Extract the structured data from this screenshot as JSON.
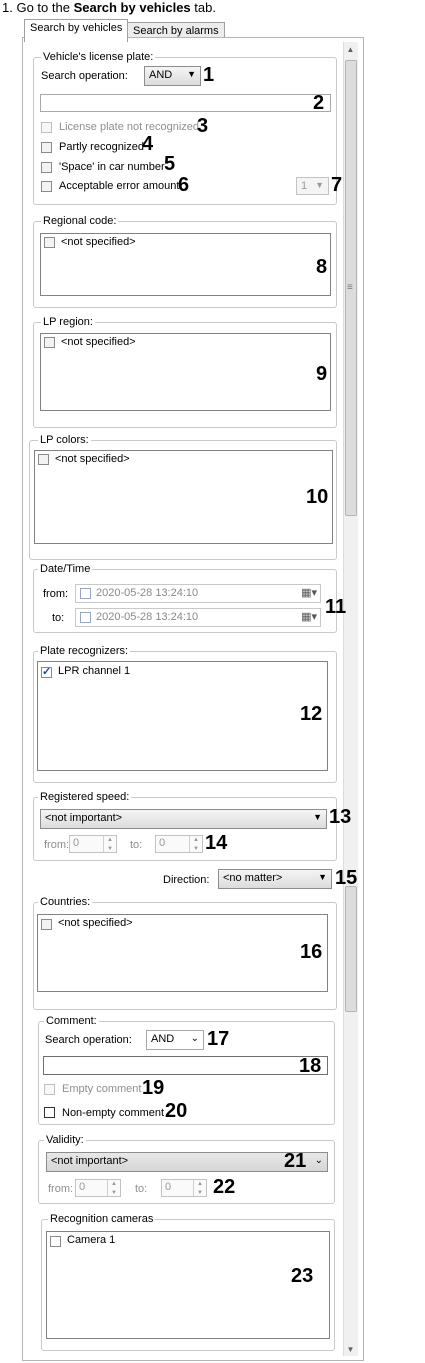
{
  "intro": {
    "number": "1.",
    "prefix": "Go to the",
    "tab_name": "Search by vehicles",
    "suffix": "tab."
  },
  "tabs": [
    "Search by vehicles",
    "Search by alarms"
  ],
  "plate": {
    "legend": "Vehicle's license plate:",
    "search_operation_label": "Search operation:",
    "search_operation_value": "AND",
    "plate_value": "",
    "not_recognized_label": "License plate not recognized",
    "partly_label": "Partly recognized",
    "space_label": "'Space' in car number",
    "error_label": "Acceptable error amount",
    "error_value": "1"
  },
  "regional": {
    "legend": "Regional code:",
    "item": "<not specified>"
  },
  "lp_region": {
    "legend": "LP region:",
    "item": "<not specified>"
  },
  "lp_colors": {
    "legend": "LP colors:",
    "item": "<not specified>"
  },
  "datetime": {
    "legend": "Date/Time",
    "from_label": "from:",
    "to_label": "to:",
    "from_value": "2020-05-28 13:24:10",
    "to_value": "2020-05-28 13:24:10"
  },
  "recognizers": {
    "legend": "Plate recognizers:",
    "item": "LPR channel  1"
  },
  "speed": {
    "legend": "Registered speed:",
    "value": "<not important>",
    "from_label": "from:",
    "to_label": "to:",
    "from_value": "0",
    "to_value": "0"
  },
  "direction": {
    "label": "Direction:",
    "value": "<no matter>"
  },
  "countries": {
    "legend": "Countries:",
    "item": "<not specified>"
  },
  "comment": {
    "legend": "Comment:",
    "search_operation_label": "Search operation:",
    "search_operation_value": "AND",
    "value": "",
    "empty_label": "Empty comment",
    "nonempty_label": "Non-empty comment"
  },
  "validity": {
    "legend": "Validity:",
    "value": "<not important>",
    "from_label": "from:",
    "to_label": "to:",
    "from_value": "0",
    "to_value": "0"
  },
  "cameras": {
    "legend": "Recognition cameras",
    "item": "Camera 1"
  },
  "callouts": [
    "1",
    "2",
    "3",
    "4",
    "5",
    "6",
    "7",
    "8",
    "9",
    "10",
    "11",
    "12",
    "13",
    "14",
    "15",
    "16",
    "17",
    "18",
    "19",
    "20",
    "21",
    "22",
    "23"
  ]
}
